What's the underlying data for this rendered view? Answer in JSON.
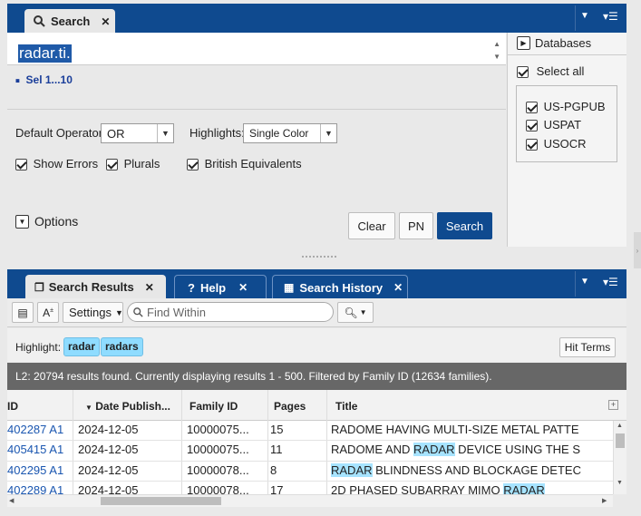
{
  "search_panel": {
    "tab_label": "Search",
    "query": "radar.ti.",
    "history_line": "Sel 1...10",
    "default_operator_label": "Default Operator:",
    "default_operator_value": "OR",
    "highlights_label": "Highlights:",
    "highlights_value": "Single Color",
    "show_errors": "Show Errors",
    "plurals": "Plurals",
    "british": "British Equivalents",
    "options": "Options",
    "clear": "Clear",
    "pn": "PN",
    "search": "Search"
  },
  "databases": {
    "title": "Databases",
    "select_all": "Select all",
    "items": [
      "US-PGPUB",
      "USPAT",
      "USOCR"
    ]
  },
  "results_panel": {
    "tabs": [
      "Search Results",
      "Help",
      "Search History"
    ],
    "settings": "Settings",
    "find_within_placeholder": "Find Within",
    "highlight_label": "Highlight:",
    "highlight_terms": [
      "radar",
      "radars"
    ],
    "hit_terms": "Hit Terms",
    "status": "L2: 20794 results found. Currently displaying results 1 - 500. Filtered by Family ID (12634 families).",
    "columns": [
      "ID",
      "Date Publish...",
      "Family ID",
      "Pages",
      "Title"
    ],
    "rows": [
      {
        "id": "402287 A1",
        "date": "2024-12-05",
        "family": "10000075...",
        "pages": "15",
        "t1": "RADOME HAVING MULTI-SIZE METAL PATTE",
        "hl": "",
        "t2": ""
      },
      {
        "id": "405415 A1",
        "date": "2024-12-05",
        "family": "10000075...",
        "pages": "11",
        "t1": "RADOME AND ",
        "hl": "RADAR",
        "t2": " DEVICE USING THE S"
      },
      {
        "id": "402295 A1",
        "date": "2024-12-05",
        "family": "10000078...",
        "pages": "8",
        "t1": "",
        "hl": "RADAR",
        "t2": " BLINDNESS AND BLOCKAGE DETEC"
      },
      {
        "id": "402289 A1",
        "date": "2024-12-05",
        "family": "10000078...",
        "pages": "17",
        "t1": "2D PHASED SUBARRAY MIMO ",
        "hl": "RADAR",
        "t2": ""
      }
    ]
  }
}
